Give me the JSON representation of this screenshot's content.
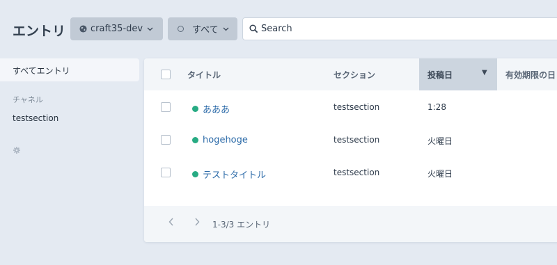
{
  "header": {
    "title": "エントリ",
    "site_label": "craft35-dev",
    "status_label": "すべて",
    "search_placeholder": "Search"
  },
  "sidebar": {
    "active_item": "すべてエントリ",
    "heading": "チャネル",
    "items": [
      {
        "label": "testsection"
      }
    ],
    "settings_icon": "gear-icon"
  },
  "table": {
    "columns": {
      "title": "タイトル",
      "section": "セクション",
      "post_date": "投稿日",
      "expiry": "有効期限の日"
    },
    "sort_indicator": "▼",
    "rows": [
      {
        "title": "あああ",
        "section": "testsection",
        "date": "1:28",
        "status_color": "#27ab83"
      },
      {
        "title": "hogehoge",
        "section": "testsection",
        "date": "火曜日",
        "status_color": "#27ab83"
      },
      {
        "title": "テストタイトル",
        "section": "testsection",
        "date": "火曜日",
        "status_color": "#27ab83"
      }
    ]
  },
  "pagination": {
    "prev_icon": "chevron-left-icon",
    "next_icon": "chevron-right-icon",
    "info": "1-3/3 エントリ"
  },
  "colors": {
    "background": "#e4eaf2",
    "link": "#2b6aa8",
    "status_live": "#27ab83",
    "button_bg": "#c1cad5",
    "sorted_header_bg": "#ccd5df"
  }
}
